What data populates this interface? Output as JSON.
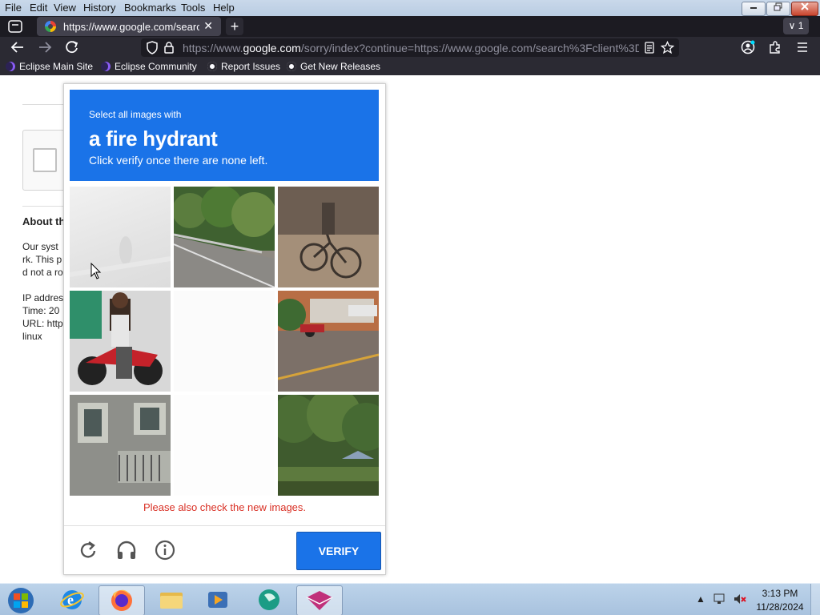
{
  "menubar": {
    "items": [
      "File",
      "Edit",
      "View",
      "History",
      "Bookmarks",
      "Tools",
      "Help"
    ],
    "window_buttons": [
      "minimize",
      "restore",
      "close"
    ]
  },
  "tabs": {
    "active_title": "https://www.google.com/searcl",
    "overflow_count": "1"
  },
  "navbar": {
    "url_prefix": "https://www.",
    "url_host": "google.com",
    "url_rest": "/sorry/index?continue=https://www.google.com/search%3Fclient%3D"
  },
  "bookmarks": [
    {
      "label": "Eclipse Main Site",
      "icon": "eclipse-icon"
    },
    {
      "label": "Eclipse Community",
      "icon": "eclipse-icon"
    },
    {
      "label": "Report Issues",
      "icon": "github-icon"
    },
    {
      "label": "Get New Releases",
      "icon": "github-icon"
    }
  ],
  "page": {
    "about_heading": "About th",
    "line1": "Our syst",
    "line2": "rk. This p",
    "line3": "d not a ro",
    "ip": "IP addres",
    "time": "Time: 20",
    "url": "URL: http",
    "ua": "linux"
  },
  "captcha": {
    "instruction": "Select all images with",
    "target": "a fire hydrant",
    "subinstruction": "Click verify once there are none left.",
    "error": "Please also check the new images.",
    "verify_label": "VERIFY",
    "accent": "#1a73e8",
    "error_color": "#d93025"
  },
  "taskbar": {
    "time": "3:13 PM",
    "date": "11/28/2024"
  }
}
